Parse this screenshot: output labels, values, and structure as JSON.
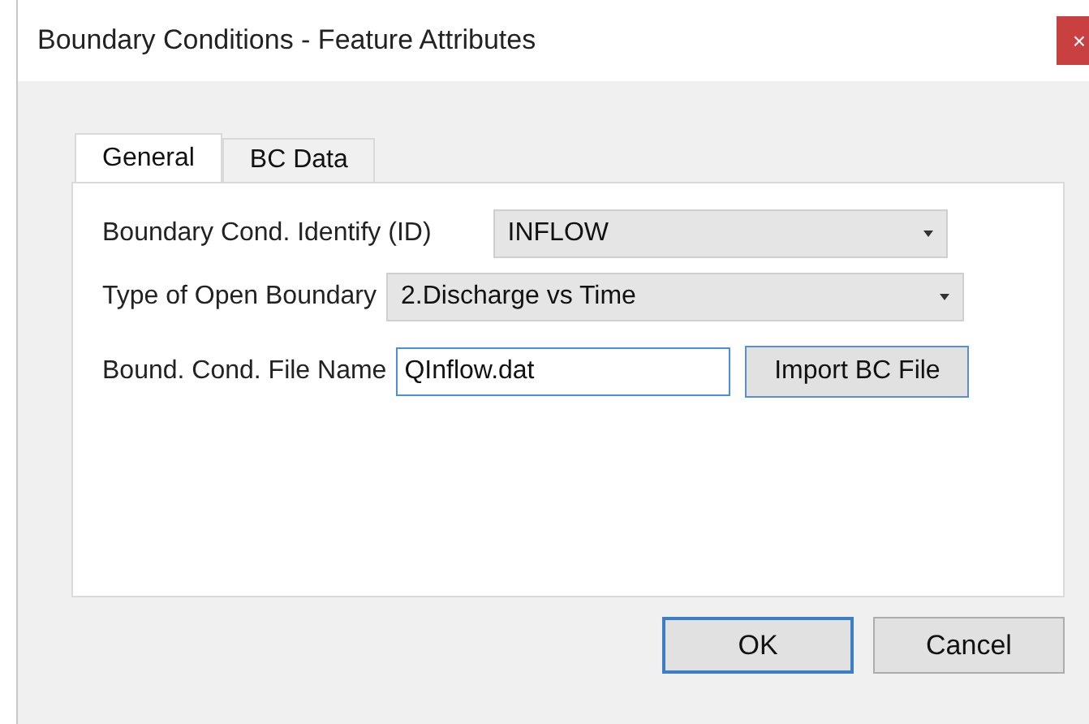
{
  "window": {
    "title": "Boundary Conditions - Feature Attributes",
    "close": "×"
  },
  "tabs": [
    {
      "label": "General",
      "selected": true
    },
    {
      "label": "BC Data",
      "selected": false
    }
  ],
  "fields": [
    {
      "kind": "dropdown",
      "label": "Boundary Cond. Identify (ID)",
      "value": "INFLOW"
    },
    {
      "kind": "dropdown",
      "label": "Type of Open Boundary",
      "value": "2.Discharge vs Time"
    },
    {
      "kind": "file",
      "label": "Bound. Cond. File Name",
      "value": "QInflow.dat",
      "button": "Import BC File"
    }
  ],
  "buttons": [
    {
      "label": "OK",
      "default": true
    },
    {
      "label": "Cancel",
      "default": false
    }
  ]
}
